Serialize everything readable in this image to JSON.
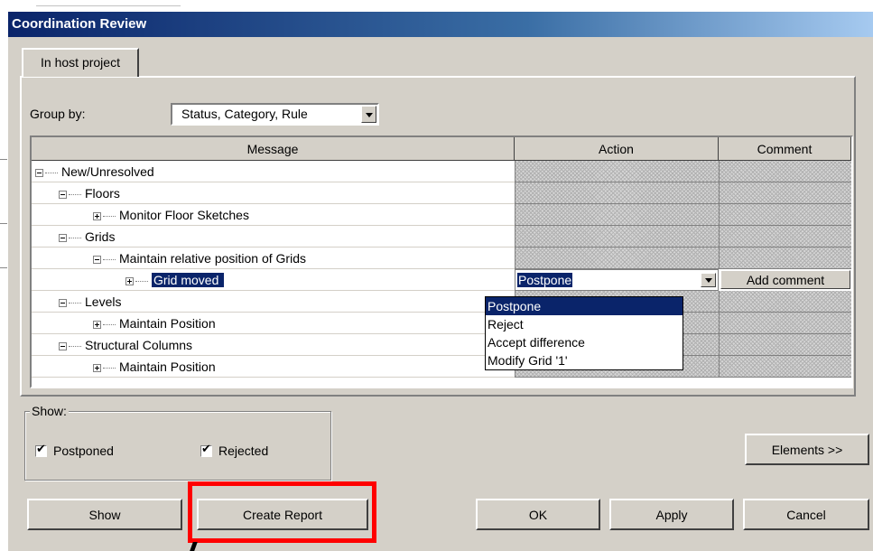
{
  "window": {
    "title": "Coordination Review"
  },
  "tabs": [
    {
      "label": "In host project"
    }
  ],
  "group_by": {
    "label": "Group by:",
    "value": "Status, Category, Rule"
  },
  "grid": {
    "headers": {
      "message": "Message",
      "action": "Action",
      "comment": "Comment"
    },
    "rows": [
      {
        "label": "New/Unresolved"
      },
      {
        "label": "Floors"
      },
      {
        "label": "Monitor Floor Sketches"
      },
      {
        "label": "Grids"
      },
      {
        "label": "Maintain relative position of Grids"
      },
      {
        "label": "Grid moved",
        "action": "Postpone",
        "comment_button": "Add comment"
      },
      {
        "label": "Levels"
      },
      {
        "label": "Maintain Position"
      },
      {
        "label": "Structural Columns"
      },
      {
        "label": "Maintain Position"
      }
    ],
    "action_options": [
      "Postpone",
      "Reject",
      "Accept difference",
      "Modify Grid '1'"
    ]
  },
  "show_group": {
    "legend": "Show:",
    "postponed": {
      "label": "Postponed",
      "checked": true
    },
    "rejected": {
      "label": "Rejected",
      "checked": true
    }
  },
  "buttons": {
    "elements": "Elements >>",
    "show": "Show",
    "create_report": "Create Report",
    "ok": "OK",
    "apply": "Apply",
    "cancel": "Cancel"
  },
  "colors": {
    "selection": "#0a246a",
    "dialog_face": "#d4d0c8",
    "annotation": "#ff0000"
  }
}
